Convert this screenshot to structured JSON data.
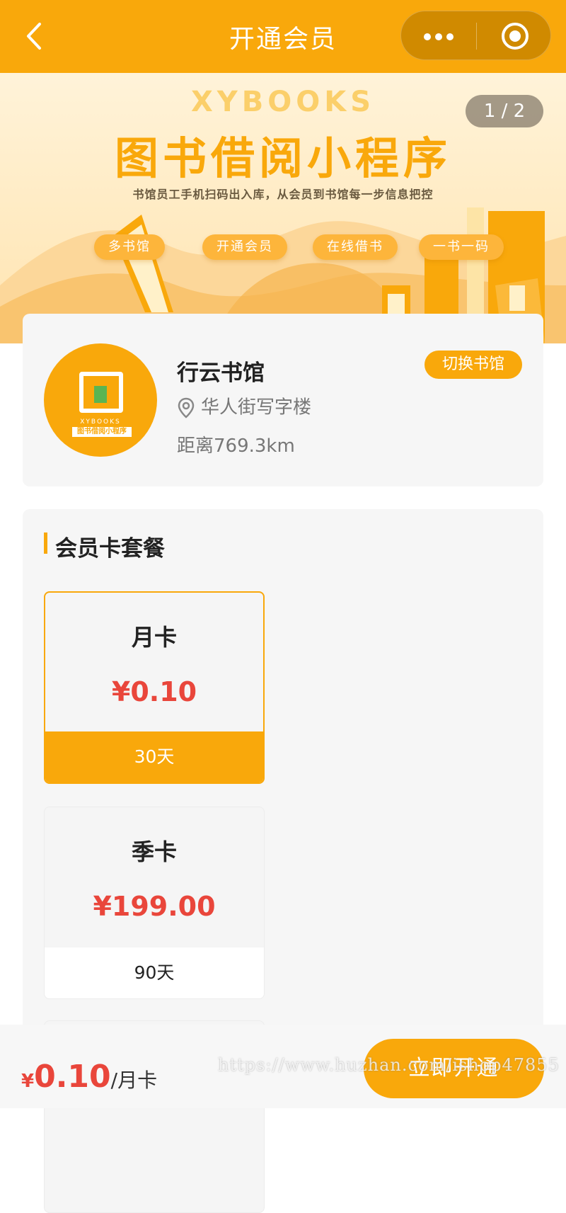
{
  "nav": {
    "title": "开通会员",
    "back_icon": "chevron-left-icon",
    "more_icon": "more-dots-icon",
    "close_icon": "capsule-close-icon"
  },
  "banner": {
    "brand": "XYBOOKS",
    "title": "图书借阅小程序",
    "subtitle": "书馆员工手机扫码出入库，从会员到书馆每一步信息把控",
    "tags": [
      "多书馆",
      "开通会员",
      "在线借书",
      "一书一码"
    ],
    "counter": "1 / 2"
  },
  "library": {
    "name": "行云书馆",
    "switch_label": "切换书馆",
    "address": "华人街写字楼",
    "distance": "距离769.3km",
    "logo_brand": "XYBOOKS",
    "logo_plate": "图书借阅小程序"
  },
  "plans": {
    "section_title": "会员卡套餐",
    "items": [
      {
        "name": "月卡",
        "price": "¥0.10",
        "days": "30天",
        "selected": true
      },
      {
        "name": "季卡",
        "price": "¥199.00",
        "days": "90天",
        "selected": false
      }
    ]
  },
  "bottom": {
    "currency": "¥",
    "amount": "0.10",
    "unit": "/月卡",
    "button_label": "立即开通"
  },
  "watermark": "https://www.huzhan.com/ishop47855",
  "colors": {
    "primary": "#f9a80b",
    "price_red": "#e9463b",
    "card_bg": "#f6f6f6"
  }
}
